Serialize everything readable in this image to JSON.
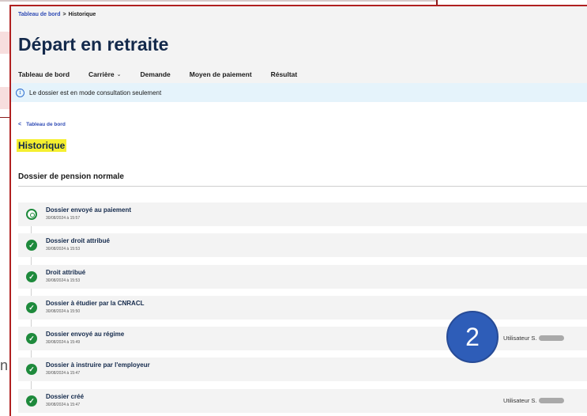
{
  "breadcrumb": {
    "home": "Tableau de bord",
    "separator": ">",
    "current": "Historique"
  },
  "app_title": "Départ en retraite",
  "nav": [
    {
      "label": "Tableau de bord",
      "dropdown": false
    },
    {
      "label": "Carrière",
      "dropdown": true
    },
    {
      "label": "Demande",
      "dropdown": false
    },
    {
      "label": "Moyen de paiement",
      "dropdown": false
    },
    {
      "label": "Résultat",
      "dropdown": false
    }
  ],
  "info": {
    "icon": "info-icon",
    "text": "Le dossier est en mode consultation seulement"
  },
  "back_link": {
    "arrow": "<",
    "label": "Tableau de bord"
  },
  "page_title": "Historique",
  "section_title": "Dossier de pension normale",
  "history": [
    {
      "label": "Dossier envoyé au paiement",
      "date": "30/08/2024 à 15:57",
      "status": "current",
      "user": ""
    },
    {
      "label": "Dossier droit attribué",
      "date": "30/08/2024 à 15:53",
      "status": "done",
      "user": ""
    },
    {
      "label": "Droit attribué",
      "date": "30/08/2024 à 15:53",
      "status": "done",
      "user": ""
    },
    {
      "label": "Dossier à étudier par la CNRACL",
      "date": "30/08/2024 à 15:50",
      "status": "done",
      "user": ""
    },
    {
      "label": "Dossier envoyé au régime",
      "date": "30/08/2024 à 15:49",
      "status": "done",
      "user": "Utilisateur S."
    },
    {
      "label": "Dossier à instruire par l'employeur",
      "date": "30/08/2024 à 15:47",
      "status": "done",
      "user": ""
    },
    {
      "label": "Dossier créé",
      "date": "30/08/2024 à 15:47",
      "status": "done",
      "user": "Utilisateur S."
    }
  ],
  "badge": "2",
  "outer_fragment": "n",
  "colors": {
    "primary": "#13294b",
    "success": "#1e8a3c",
    "info_bg": "#e5f3fb",
    "highlight": "#f5ef2f",
    "badge": "#2e5db8"
  }
}
